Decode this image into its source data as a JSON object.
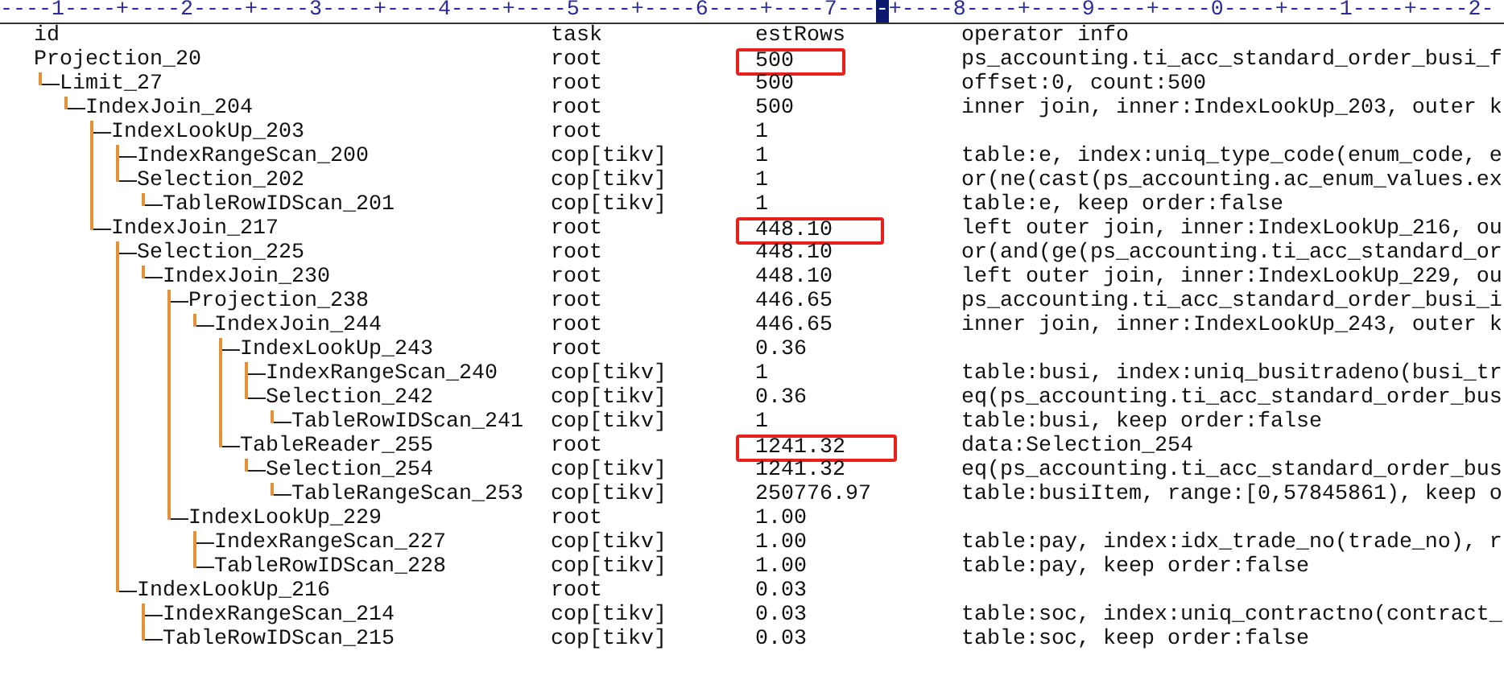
{
  "ruler": {
    "before": "----1----+----2----+----3----+----4----+----5----+----6----+----7---",
    "cursor": "-",
    "after": "+----8----+----9----+----0----+----1----+----2-"
  },
  "columns": [
    "id",
    "task",
    "estRows",
    "operator info"
  ],
  "rows": [
    {
      "id": "Projection_20",
      "task": "root",
      "estRows": "500",
      "highlighted": true,
      "info": "ps_accounting.ti_acc_standard_order_busi_f",
      "children": [
        {
          "id": "Limit_27",
          "task": "root",
          "estRows": "500",
          "highlighted": false,
          "info": "offset:0, count:500",
          "children": [
            {
              "id": "IndexJoin_204",
              "task": "root",
              "estRows": "500",
              "highlighted": false,
              "info": "inner join, inner:IndexLookUp_203, outer k",
              "children": [
                {
                  "id": "IndexLookUp_203",
                  "task": "root",
                  "estRows": "1",
                  "highlighted": false,
                  "children": [
                    {
                      "id": "IndexRangeScan_200",
                      "task": "cop[tikv]",
                      "estRows": "1",
                      "highlighted": false,
                      "info": "table:e, index:uniq_type_code(enum_code, e"
                    },
                    {
                      "id": "Selection_202",
                      "task": "cop[tikv]",
                      "estRows": "1",
                      "highlighted": false,
                      "info": "or(ne(cast(ps_accounting.ac_enum_values.ex",
                      "children": [
                        {
                          "id": "TableRowIDScan_201",
                          "task": "cop[tikv]",
                          "estRows": "1",
                          "highlighted": false,
                          "info": "table:e, keep order:false"
                        }
                      ]
                    }
                  ]
                },
                {
                  "id": "IndexJoin_217",
                  "task": "root",
                  "estRows": "448.10",
                  "highlighted": true,
                  "info": "left outer join, inner:IndexLookUp_216, ou",
                  "children": [
                    {
                      "id": "Selection_225",
                      "task": "root",
                      "estRows": "448.10",
                      "highlighted": false,
                      "info": "or(and(ge(ps_accounting.ti_acc_standard_or",
                      "children": [
                        {
                          "id": "IndexJoin_230",
                          "task": "root",
                          "estRows": "448.10",
                          "highlighted": false,
                          "info": "left outer join, inner:IndexLookUp_229, ou",
                          "children": [
                            {
                              "id": "Projection_238",
                              "task": "root",
                              "estRows": "446.65",
                              "highlighted": false,
                              "info": "ps_accounting.ti_acc_standard_order_busi_i",
                              "children": [
                                {
                                  "id": "IndexJoin_244",
                                  "task": "root",
                                  "estRows": "446.65",
                                  "highlighted": false,
                                  "info": "inner join, inner:IndexLookUp_243, outer k",
                                  "children": [
                                    {
                                      "id": "IndexLookUp_243",
                                      "task": "root",
                                      "estRows": "0.36",
                                      "highlighted": false,
                                      "children": [
                                        {
                                          "id": "IndexRangeScan_240",
                                          "task": "cop[tikv]",
                                          "estRows": "1",
                                          "highlighted": false,
                                          "info": "table:busi, index:uniq_busitradeno(busi_tr"
                                        },
                                        {
                                          "id": "Selection_242",
                                          "task": "cop[tikv]",
                                          "estRows": "0.36",
                                          "highlighted": false,
                                          "info": "eq(ps_accounting.ti_acc_standard_order_bus",
                                          "children": [
                                            {
                                              "id": "TableRowIDScan_241",
                                              "task": "cop[tikv]",
                                              "estRows": "1",
                                              "highlighted": false,
                                              "info": "table:busi, keep order:false"
                                            }
                                          ]
                                        }
                                      ]
                                    },
                                    {
                                      "id": "TableReader_255",
                                      "task": "root",
                                      "estRows": "1241.32",
                                      "highlighted": true,
                                      "info": "data:Selection_254",
                                      "children": [
                                        {
                                          "id": "Selection_254",
                                          "task": "cop[tikv]",
                                          "estRows": "1241.32",
                                          "highlighted": false,
                                          "info": "eq(ps_accounting.ti_acc_standard_order_bus",
                                          "children": [
                                            {
                                              "id": "TableRangeScan_253",
                                              "task": "cop[tikv]",
                                              "estRows": "250776.97",
                                              "highlighted": false,
                                              "info": "table:busiItem, range:[0,57845861), keep o"
                                            }
                                          ]
                                        }
                                      ]
                                    }
                                  ]
                                }
                              ]
                            },
                            {
                              "id": "IndexLookUp_229",
                              "task": "root",
                              "estRows": "1.00",
                              "highlighted": false,
                              "children": [
                                {
                                  "id": "IndexRangeScan_227",
                                  "task": "cop[tikv]",
                                  "estRows": "1.00",
                                  "highlighted": false,
                                  "info": "table:pay, index:idx_trade_no(trade_no), r"
                                },
                                {
                                  "id": "TableRowIDScan_228",
                                  "task": "cop[tikv]",
                                  "estRows": "1.00",
                                  "highlighted": false,
                                  "info": "table:pay, keep order:false"
                                }
                              ]
                            }
                          ]
                        }
                      ]
                    },
                    {
                      "id": "IndexLookUp_216",
                      "task": "root",
                      "estRows": "0.03",
                      "highlighted": false,
                      "children": [
                        {
                          "id": "IndexRangeScan_214",
                          "task": "cop[tikv]",
                          "estRows": "0.03",
                          "highlighted": false,
                          "info": "table:soc, index:uniq_contractno(contract_"
                        },
                        {
                          "id": "TableRowIDScan_215",
                          "task": "cop[tikv]",
                          "estRows": "0.03",
                          "highlighted": false,
                          "info": "table:soc, keep order:false"
                        }
                      ]
                    }
                  ]
                }
              ]
            }
          ]
        }
      ]
    }
  ]
}
